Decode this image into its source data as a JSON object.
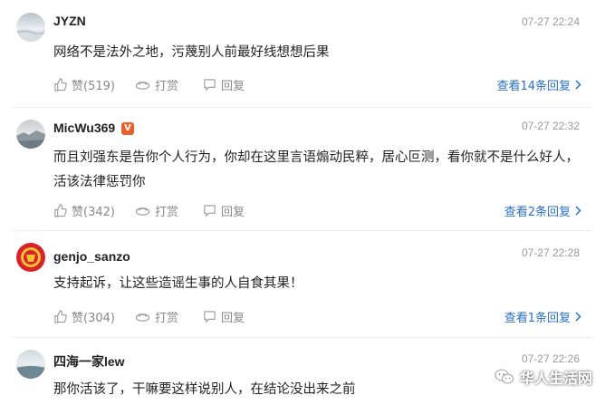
{
  "comments": [
    {
      "username": "JYZN",
      "time": "07-27 22:24",
      "text": "网络不是法外之地，污蔑别人前最好线想想后果",
      "like_label": "赞(519)",
      "tip_label": "打赏",
      "reply_label": "回复",
      "replies_link": "查看14条回复"
    },
    {
      "username": "MicWu369",
      "badge": "V",
      "time": "07-27 22:32",
      "text": "而且刘强东是告你个人行为，你却在这里言语煽动民粹，居心叵测，看你就不是什么好人，活该法律惩罚你",
      "like_label": "赞(342)",
      "tip_label": "打赏",
      "reply_label": "回复",
      "replies_link": "查看2条回复"
    },
    {
      "username": "genjo_sanzo",
      "time": "07-27 22:28",
      "text": "支持起诉，让这些造谣生事的人自食其果！",
      "like_label": "赞(304)",
      "tip_label": "打赏",
      "reply_label": "回复",
      "replies_link": "查看1条回复"
    },
    {
      "username": "四海一家lew",
      "time": "07-27 22:26",
      "text": "那你活该了，干嘛要这样说别人，在结论没出来之前"
    }
  ],
  "watermark": {
    "text": "华人生活网",
    "icon": "wechat-icon"
  },
  "colors": {
    "link": "#2a6fc9",
    "meta": "#999999",
    "badge": "#e8612c"
  }
}
